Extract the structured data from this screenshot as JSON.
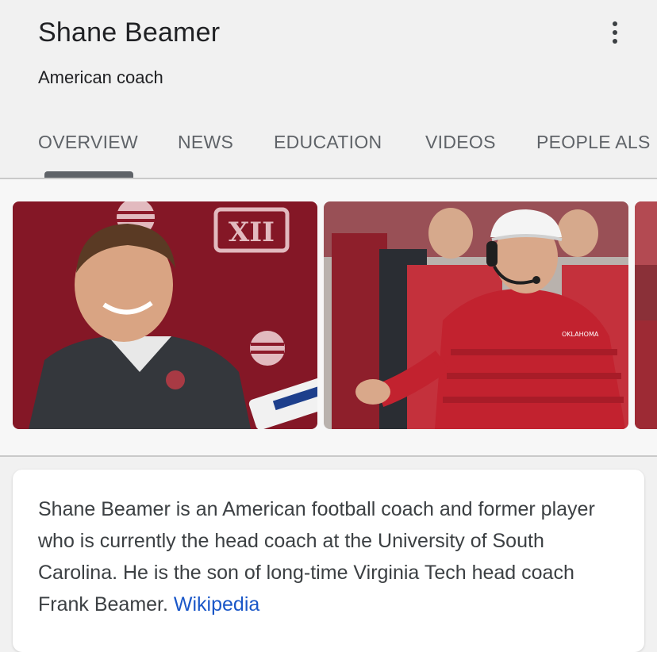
{
  "header": {
    "title": "Shane Beamer",
    "subtitle": "American coach"
  },
  "tabs": [
    {
      "label": "OVERVIEW",
      "active": true
    },
    {
      "label": "NEWS"
    },
    {
      "label": "EDUCATION"
    },
    {
      "label": "VIDEOS"
    },
    {
      "label": "PEOPLE ALS"
    }
  ],
  "description": {
    "text": "Shane Beamer is an American football coach and former player who is currently the head coach at the University of South Carolina. He is the son of long-time Virginia Tech head coach Frank Beamer.",
    "source": "Wikipedia"
  },
  "colors": {
    "link": "#1a57c8",
    "text": "#3c4043",
    "background": "#f1f1f1",
    "crimson": "#8e1a2a"
  },
  "icons": {
    "more": "more-vert-icon"
  }
}
